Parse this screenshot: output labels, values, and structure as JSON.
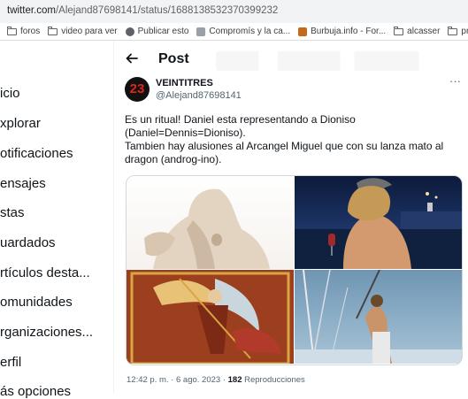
{
  "browser": {
    "url_host": "twitter.com",
    "url_path": "/Alejand87698141/status/1688138532370399232",
    "bookmarks": [
      {
        "label": "foros",
        "icon": "folder-icon"
      },
      {
        "label": "video para ver",
        "icon": "folder-icon"
      },
      {
        "label": "Publicar esto",
        "icon": "globe-icon"
      },
      {
        "label": "Compromís y la ca...",
        "icon": "site-favicon"
      },
      {
        "label": "Burbuja.info - For...",
        "icon": "burbuja-favicon"
      },
      {
        "label": "alcasser",
        "icon": "folder-icon"
      },
      {
        "label": "prestige",
        "icon": "folder-icon"
      }
    ]
  },
  "sidebar": {
    "items": [
      {
        "label": "icio"
      },
      {
        "label": "xplorar"
      },
      {
        "label": "otificaciones"
      },
      {
        "label": "ensajes"
      },
      {
        "label": "stas"
      },
      {
        "label": "uardados"
      },
      {
        "label": "rtículos desta..."
      },
      {
        "label": "omunidades"
      },
      {
        "label": "rganizaciones..."
      },
      {
        "label": "erfil"
      },
      {
        "label": "ás opciones"
      }
    ]
  },
  "header": {
    "back_icon": "arrow-left-icon",
    "title": "Post"
  },
  "tweet": {
    "avatar_text": "23",
    "display_name": "VEINTITRES",
    "handle": "@Alejand87698141",
    "more_icon": "···",
    "text_lines": [
      "Es un ritual! Daniel esta representando a Dioniso",
      "(Daniel=Dennis=Dioniso).",
      "Tambien hay alusiones al Arcangel Miguel que con su lanza mato al",
      "dragon (androg-ino)."
    ],
    "images": [
      {
        "subject": "marble statue torso"
      },
      {
        "subject": "man with cap and wine glass at night on boat"
      },
      {
        "subject": "archangel Michael slaying dragon painting"
      },
      {
        "subject": "man on sailboat mast"
      }
    ],
    "time": "12:42 p. m.",
    "separator": "·",
    "date": "6 ago. 2023",
    "views_count": "182",
    "views_label": "Reproducciones"
  }
}
